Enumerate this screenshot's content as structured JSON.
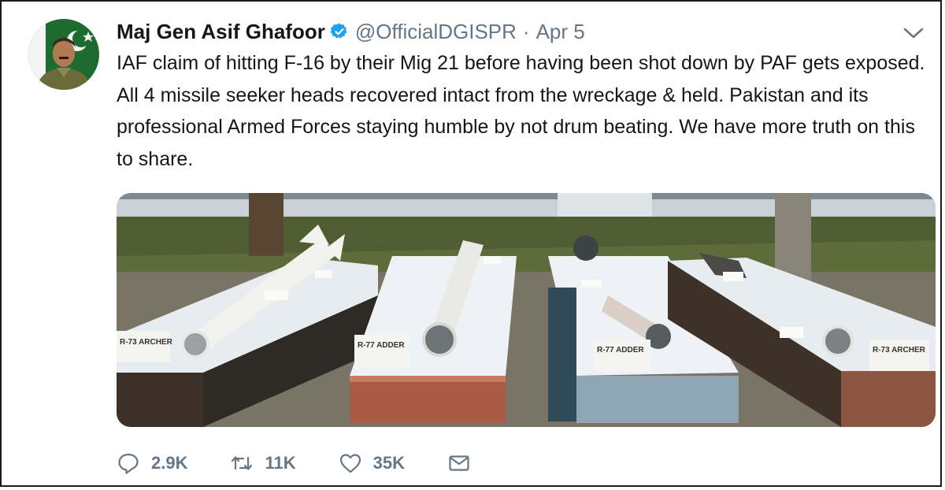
{
  "tweet": {
    "author_name": "Maj Gen Asif Ghafoor",
    "handle": "@OfficialDGISPR",
    "separator": "·",
    "date": "Apr 5",
    "verified": true,
    "text": "IAF claim of hitting F-16 by their Mig 21 before having been shot down by PAF gets exposed. All 4 missile seeker heads recovered intact from the wreckage & held. Pakistan and its professional Armed Forces staying humble by not drum beating. We have more truth on this to share.",
    "icons": {
      "verified": "verified-badge-icon",
      "menu": "chevron-down-icon",
      "reply": "reply-icon",
      "retweet": "retweet-icon",
      "like": "heart-icon",
      "dm": "envelope-icon"
    },
    "colors": {
      "verified": "#1da1f2",
      "muted": "#657786",
      "text": "#14171a"
    }
  },
  "media": {
    "labels": {
      "left": "R-73 ARCHER",
      "center_left": "R-77 ADDER",
      "center_right": "R-77 ADDER",
      "right": "R-73 ARCHER"
    }
  },
  "actions": {
    "reply_count": "2.9K",
    "retweet_count": "11K",
    "like_count": "35K"
  }
}
